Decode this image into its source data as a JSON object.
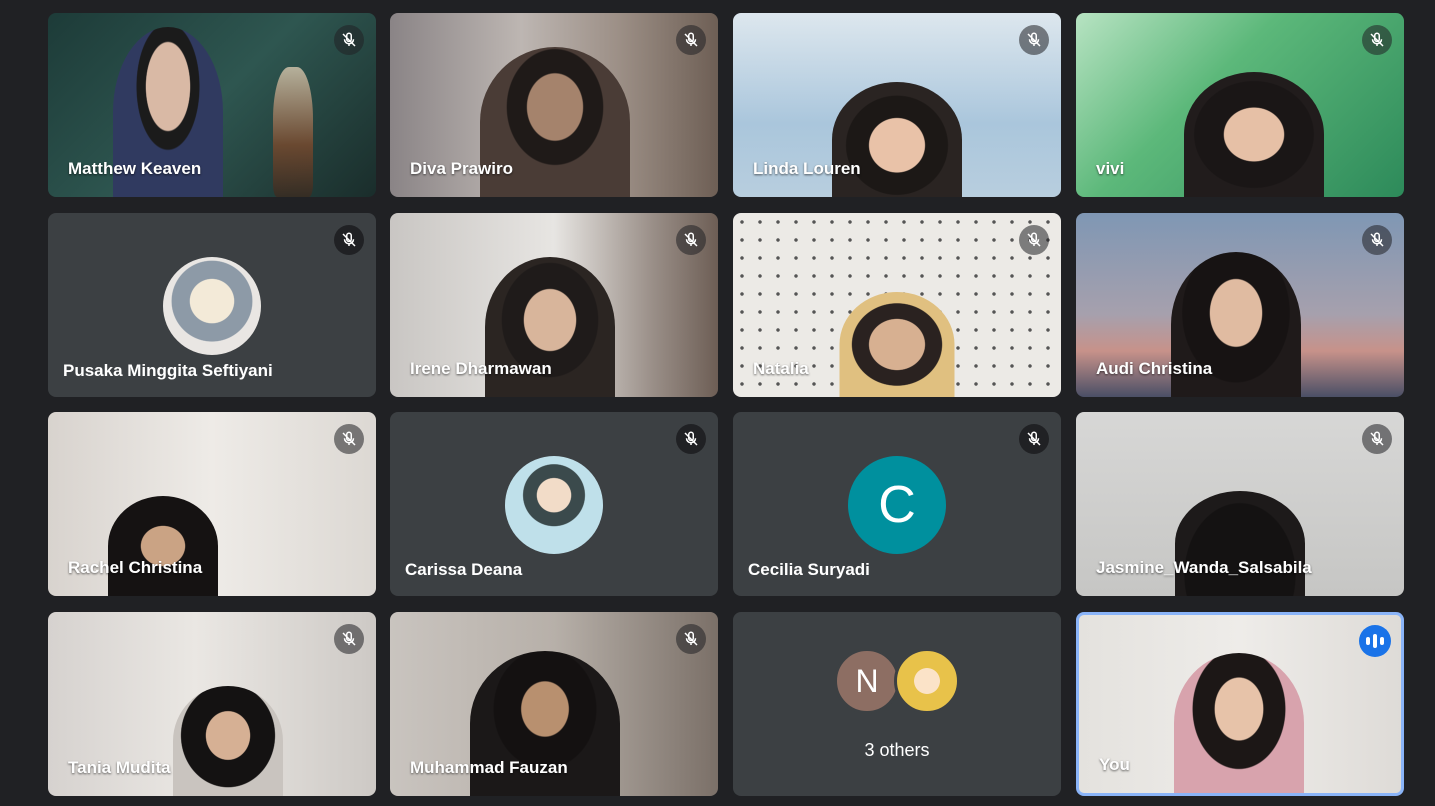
{
  "participants": [
    {
      "name": "Matthew Keaven",
      "muted": true
    },
    {
      "name": "Diva Prawiro",
      "muted": true
    },
    {
      "name": "Linda Louren",
      "muted": true
    },
    {
      "name": "vivi",
      "muted": true
    },
    {
      "name": "Pusaka Minggita Seftiyani",
      "muted": true
    },
    {
      "name": "Irene Dharmawan",
      "muted": true
    },
    {
      "name": "Natalia",
      "muted": true
    },
    {
      "name": "Audi Christina",
      "muted": true
    },
    {
      "name": "Rachel Christina",
      "muted": true
    },
    {
      "name": "Carissa Deana",
      "muted": true
    },
    {
      "name": "Cecilia Suryadi",
      "muted": true,
      "initial": "C"
    },
    {
      "name": "Jasmine_Wanda_Salsabila",
      "muted": true
    },
    {
      "name": "Tania Mudita",
      "muted": true
    },
    {
      "name": "Muhammad Fauzan",
      "muted": true
    },
    {
      "others_label": "3 others",
      "initial": "N"
    },
    {
      "name": "You",
      "speaking": true
    }
  ],
  "colors": {
    "background": "#202124",
    "tile_avatar_bg": "#3c4043",
    "active_border": "#8ab4f8",
    "speaking_badge": "#1a73e8",
    "cecilia_avatar": "#00909e",
    "n_avatar": "#8d6e63"
  }
}
